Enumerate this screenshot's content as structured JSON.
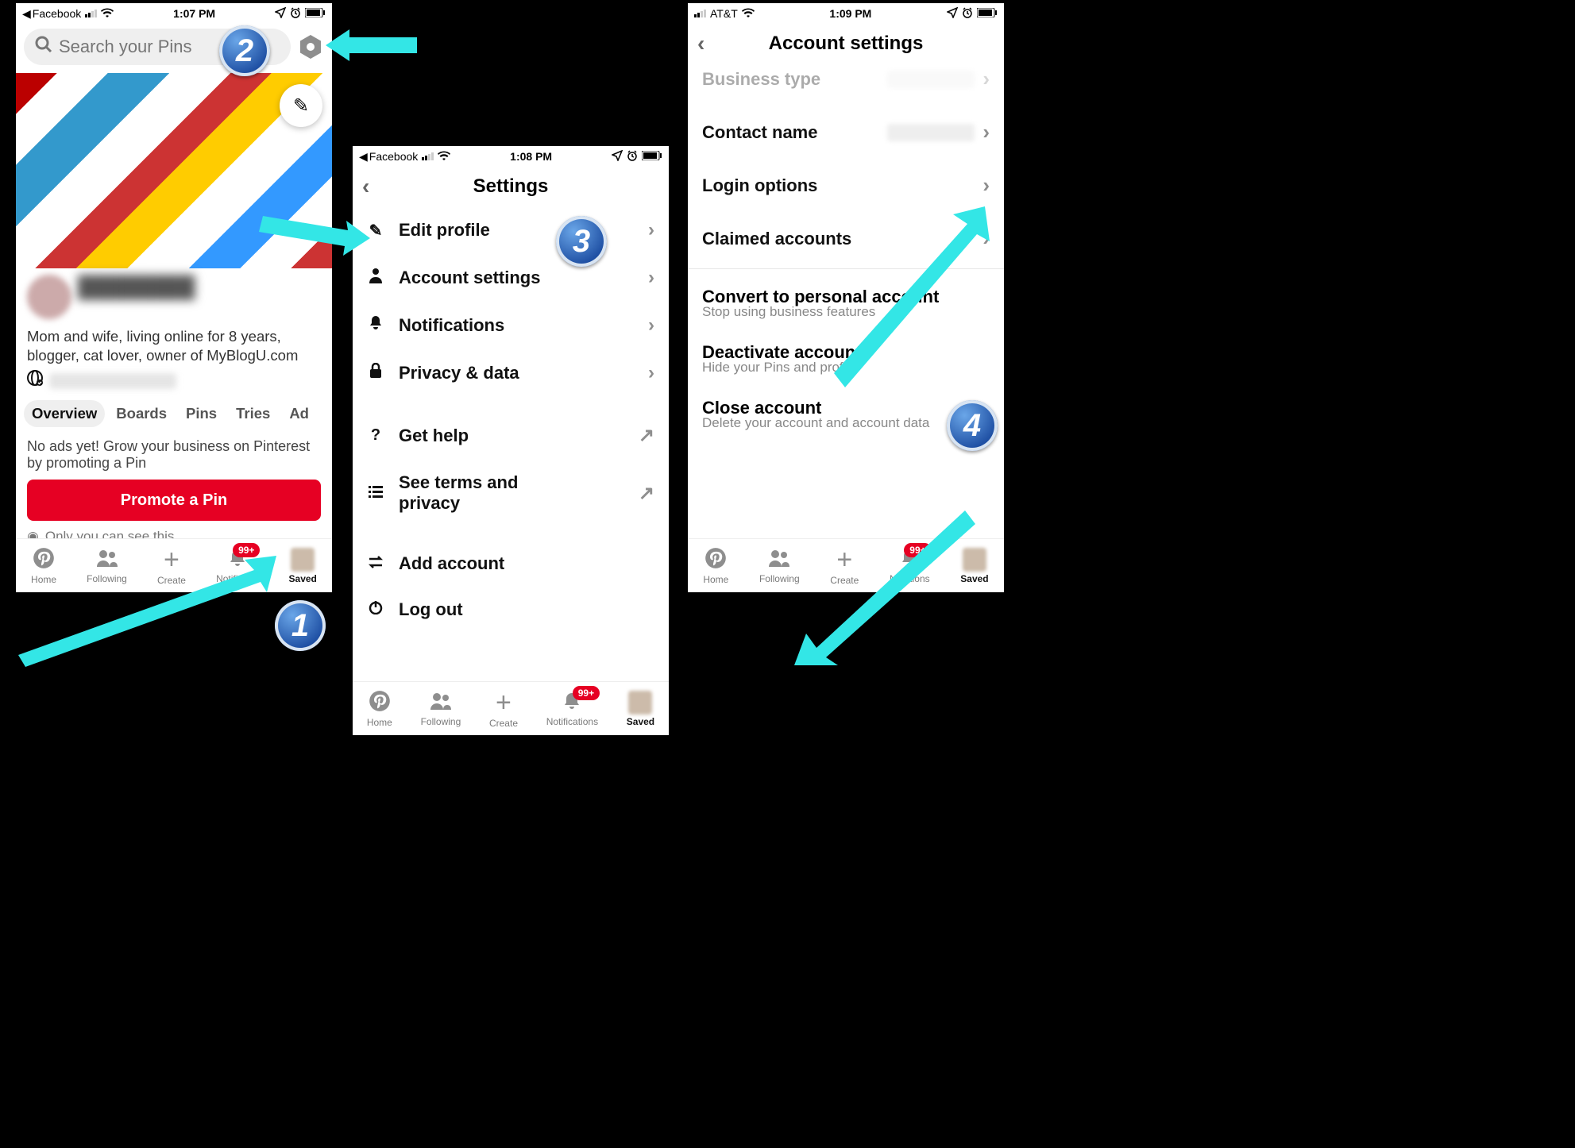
{
  "phone1": {
    "status": {
      "back": "Facebook",
      "time": "1:07 PM"
    },
    "search_placeholder": "Search your Pins",
    "bio": "Mom and wife, living online for 8 years, blogger, cat lover, owner of MyBlogU.com",
    "tabs": {
      "overview": "Overview",
      "boards": "Boards",
      "pins": "Pins",
      "tries": "Tries",
      "more": "Ad"
    },
    "grow_text": "No ads yet! Grow your business on Pinterest by promoting a Pin",
    "promote_btn": "Promote a Pin",
    "eye_text": "Only you can see this",
    "nav": {
      "home": "Home",
      "following": "Following",
      "create": "Create",
      "notifications": "Notificat...",
      "saved": "Saved",
      "badge": "99+"
    }
  },
  "phone2": {
    "status": {
      "back": "Facebook",
      "time": "1:08 PM"
    },
    "title": "Settings",
    "items": {
      "edit_profile": "Edit profile",
      "account_settings": "Account settings",
      "notifications": "Notifications",
      "privacy": "Privacy & data",
      "get_help": "Get help",
      "terms": "See terms and privacy",
      "add_account": "Add account",
      "log_out": "Log out"
    },
    "nav": {
      "home": "Home",
      "following": "Following",
      "create": "Create",
      "notifications": "Notifications",
      "saved": "Saved",
      "badge": "99+"
    }
  },
  "phone3": {
    "status": {
      "carrier": "AT&T",
      "time": "1:09 PM"
    },
    "title": "Account settings",
    "rows": {
      "business_type": "Business type",
      "contact_name": "Contact name",
      "login_options": "Login options",
      "claimed": "Claimed accounts",
      "convert": "Convert to personal account",
      "convert_sub": "Stop using business features",
      "deactivate": "Deactivate account",
      "deactivate_sub": "Hide your Pins and profile",
      "close": "Close account",
      "close_sub": "Delete your account and account data"
    },
    "nav": {
      "home": "Home",
      "following": "Following",
      "create": "Create",
      "notifications": "N...ations",
      "saved": "Saved",
      "badge": "99+"
    }
  }
}
